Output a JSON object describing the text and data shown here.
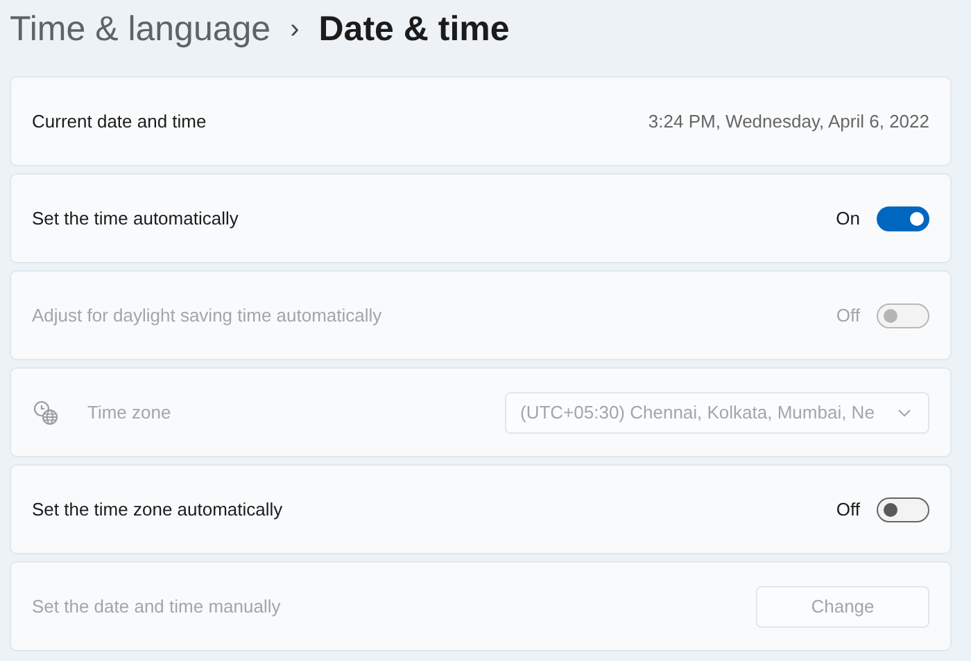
{
  "breadcrumb": {
    "parent": "Time & language",
    "separator": "›",
    "current": "Date & time"
  },
  "rows": [
    {
      "kind": "info",
      "label": "Current date and time",
      "value": "3:24 PM, Wednesday, April 6, 2022",
      "disabled": false
    },
    {
      "kind": "toggle",
      "label": "Set the time automatically",
      "state_text": "On",
      "on": true,
      "disabled": false
    },
    {
      "kind": "toggle",
      "label": "Adjust for daylight saving time automatically",
      "state_text": "Off",
      "on": false,
      "disabled": true
    },
    {
      "kind": "dropdown",
      "label": "Time zone",
      "value": "(UTC+05:30) Chennai, Kolkata, Mumbai, Ne",
      "disabled": true
    },
    {
      "kind": "toggle",
      "label": "Set the time zone automatically",
      "state_text": "Off",
      "on": false,
      "disabled": false
    },
    {
      "kind": "button",
      "label": "Set the date and time manually",
      "button": "Change",
      "disabled": true
    }
  ]
}
